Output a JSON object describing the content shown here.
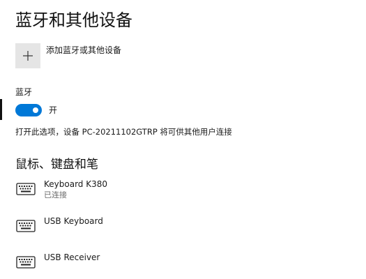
{
  "page": {
    "title": "蓝牙和其他设备"
  },
  "add_device": {
    "label": "添加蓝牙或其他设备"
  },
  "bluetooth": {
    "heading": "蓝牙",
    "toggle_state_label": "开",
    "toggle_on": true,
    "discoverable_text": "打开此选项，设备 PC-20211102GTRP 将可供其他用户连接"
  },
  "section": {
    "title": "鼠标、键盘和笔"
  },
  "devices": [
    {
      "name": "Keyboard K380",
      "status": "已连接",
      "icon": "keyboard-icon"
    },
    {
      "name": "USB Keyboard",
      "status": "",
      "icon": "keyboard-icon"
    },
    {
      "name": "USB Receiver",
      "status": "",
      "icon": "keyboard-icon"
    }
  ],
  "colors": {
    "accent": "#0078d7",
    "tile": "#e5e5e5",
    "secondary_text": "#6b6b6b"
  }
}
